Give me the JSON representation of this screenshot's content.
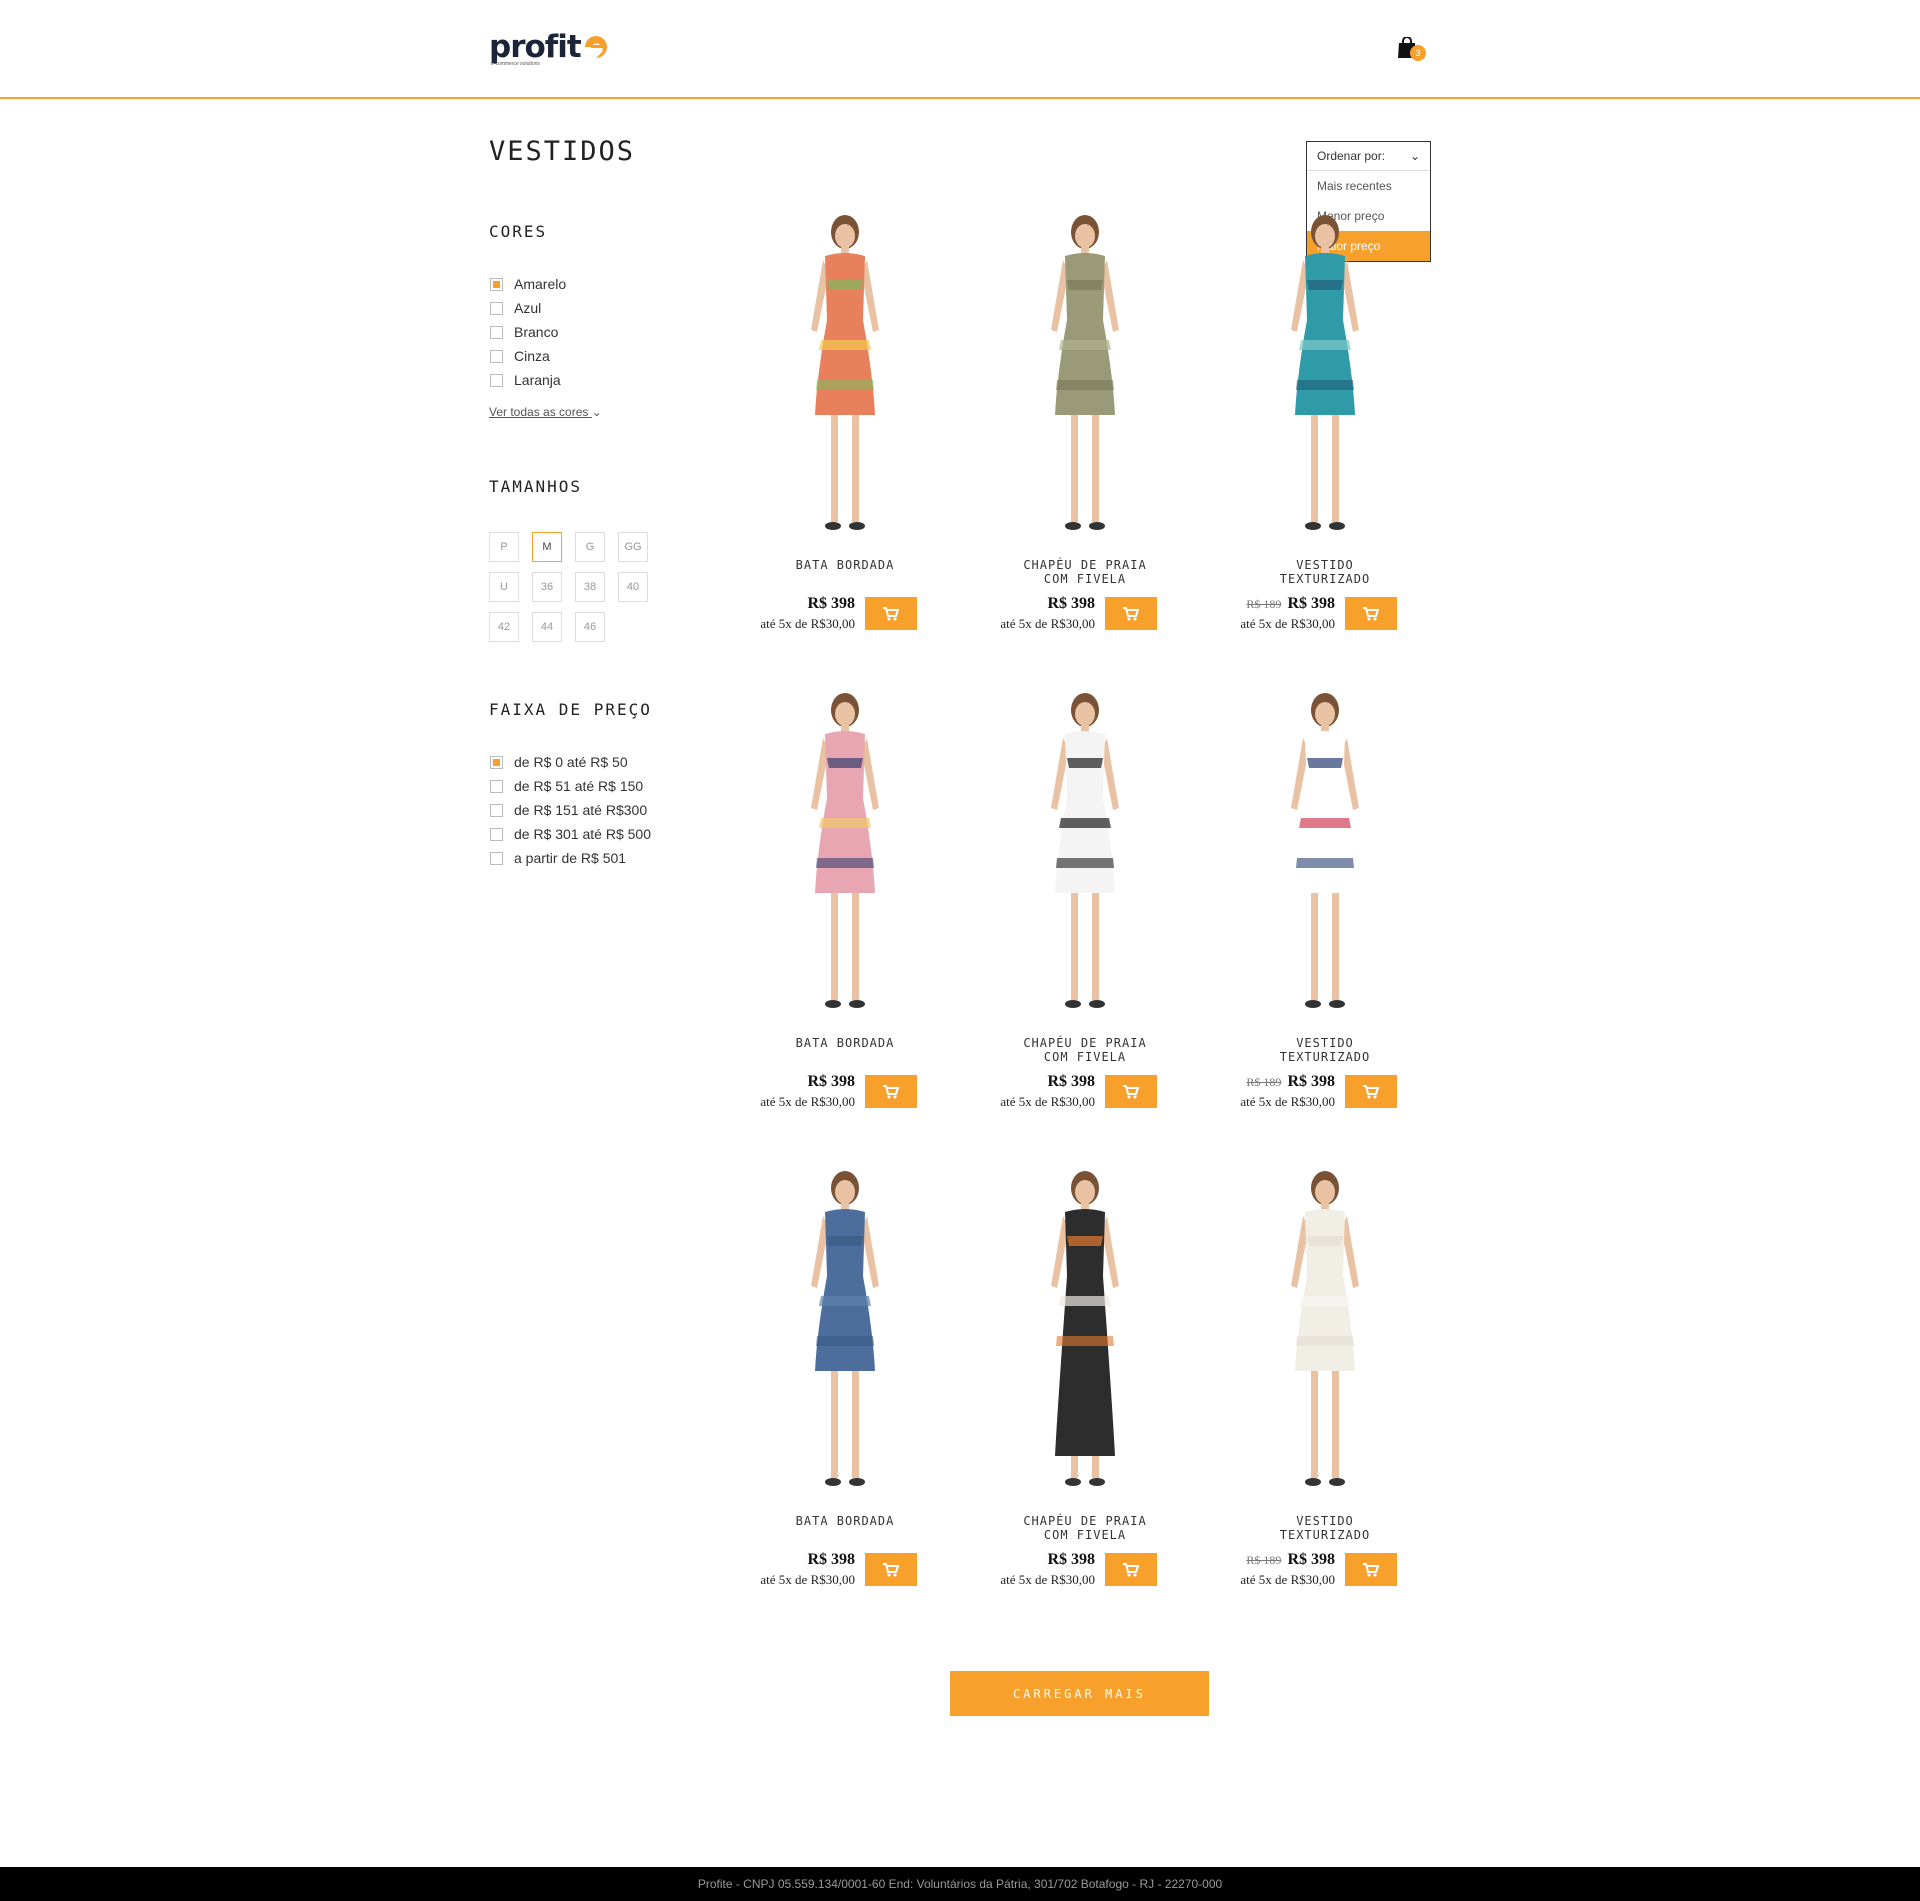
{
  "header": {
    "logo_text": "profit",
    "logo_tagline": "e-commerce solutions",
    "cart_count": "3"
  },
  "page_title": "VESTIDOS",
  "sort": {
    "label": "Ordenar por:",
    "options": [
      "Mais recentes",
      "Menor preço",
      "Maior preço"
    ],
    "selected": "Maior preço"
  },
  "filters": {
    "colors": {
      "title": "CORES",
      "items": [
        {
          "label": "Amarelo",
          "checked": true
        },
        {
          "label": "Azul",
          "checked": false
        },
        {
          "label": "Branco",
          "checked": false
        },
        {
          "label": "Cinza",
          "checked": false
        },
        {
          "label": "Laranja",
          "checked": false
        }
      ],
      "see_all": "Ver todas as cores"
    },
    "sizes": {
      "title": "TAMANHOS",
      "items": [
        "P",
        "M",
        "G",
        "GG",
        "U",
        "36",
        "38",
        "40",
        "42",
        "44",
        "46"
      ],
      "selected": "M"
    },
    "price": {
      "title": "FAIXA DE PREÇO",
      "items": [
        {
          "label": "de R$ 0 até R$ 50",
          "checked": true
        },
        {
          "label": "de R$ 51 até R$ 150",
          "checked": false
        },
        {
          "label": "de R$ 151 até R$300",
          "checked": false
        },
        {
          "label": "de R$ 301 até R$ 500",
          "checked": false
        },
        {
          "label": "a partir de R$ 501",
          "checked": false
        }
      ]
    }
  },
  "products": [
    {
      "name": "BATA BORDADA",
      "old_price": "",
      "price": "R$ 398",
      "installments": "até 5x de R$30,00",
      "dress": "floral"
    },
    {
      "name": "CHAPÉU DE PRAIA\nCOM FIVELA",
      "old_price": "",
      "price": "R$ 398",
      "installments": "até 5x de R$30,00",
      "dress": "olive"
    },
    {
      "name": "VESTIDO\nTEXTURIZADO",
      "old_price": "R$ 189",
      "price": "R$ 398",
      "installments": "até 5x de R$30,00",
      "dress": "teal"
    },
    {
      "name": "BATA BORDADA",
      "old_price": "",
      "price": "R$ 398",
      "installments": "até 5x de R$30,00",
      "dress": "pink"
    },
    {
      "name": "CHAPÉU DE PRAIA\nCOM FIVELA",
      "old_price": "",
      "price": "R$ 398",
      "installments": "até 5x de R$30,00",
      "dress": "bw"
    },
    {
      "name": "VESTIDO\nTEXTURIZADO",
      "old_price": "R$ 189",
      "price": "R$ 398",
      "installments": "até 5x de R$30,00",
      "dress": "stripe"
    },
    {
      "name": "BATA BORDADA",
      "old_price": "",
      "price": "R$ 398",
      "installments": "até 5x de R$30,00",
      "dress": "denim"
    },
    {
      "name": "CHAPÉU DE PRAIA\nCOM FIVELA",
      "old_price": "",
      "price": "R$ 398",
      "installments": "até 5x de R$30,00",
      "dress": "geo"
    },
    {
      "name": "VESTIDO\nTEXTURIZADO",
      "old_price": "R$ 189",
      "price": "R$ 398",
      "installments": "até 5x de R$30,00",
      "dress": "white"
    }
  ],
  "load_more": "CARREGAR MAIS",
  "footer": "Profite - CNPJ 05.559.134/0001-60 End: Voluntários da Pátria, 301/702 Botafogo - RJ - 22270-000",
  "colors": {
    "accent": "#f7a12c",
    "logo_dark": "#1b2438"
  }
}
